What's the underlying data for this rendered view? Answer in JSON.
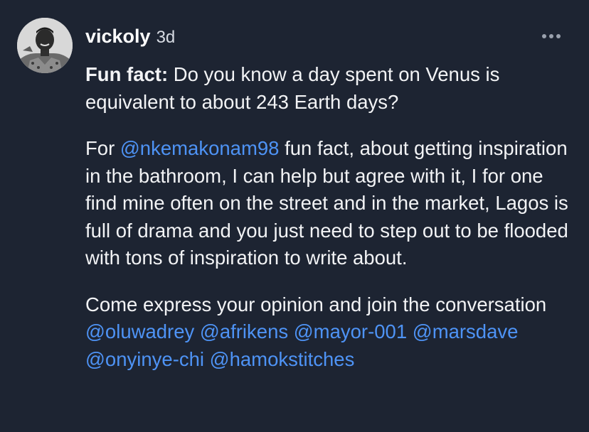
{
  "post": {
    "author": "vickoly",
    "timestamp": "3d",
    "paragraph1": {
      "bold_label": "Fun fact:",
      "text": " Do you know a day spent on Venus is equivalent to about 243 Earth days?"
    },
    "paragraph2": {
      "prefix": "For ",
      "mention": "@nkemakonam98",
      "text": " fun fact, about getting inspiration in the bathroom, I can help but agree with it, I for one find mine often on the street and in the market, Lagos is full of drama and you just need to step out to be flooded with tons of inspiration to write about."
    },
    "paragraph3": {
      "text": "Come express your opinion and join the conversation ",
      "mentions": [
        "@oluwadrey",
        "@afrikens",
        "@mayor-001",
        "@marsdave",
        "@onyinye-chi",
        "@hamokstitches"
      ]
    }
  },
  "colors": {
    "background": "#1d2432",
    "text": "#f2f3f5",
    "mention": "#4e93f5",
    "menu_dots": "#9aa1ad"
  },
  "icons": {
    "avatar": "user-avatar-photo",
    "more": "more-horizontal-icon"
  }
}
